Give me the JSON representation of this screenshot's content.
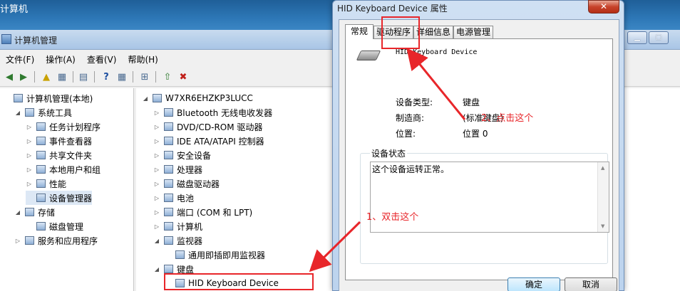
{
  "desktop": {
    "title": "计算机"
  },
  "mmc": {
    "title": "计算机管理",
    "menu": [
      "文件(F)",
      "操作(A)",
      "查看(V)",
      "帮助(H)"
    ]
  },
  "left_tree": [
    {
      "label": "计算机管理(本地)",
      "depth": 0,
      "expander": "",
      "icon": "computer-management-icon"
    },
    {
      "label": "系统工具",
      "depth": 1,
      "expander": "◢",
      "icon": "tools-icon"
    },
    {
      "label": "任务计划程序",
      "depth": 2,
      "expander": "▷",
      "icon": "clock-icon"
    },
    {
      "label": "事件查看器",
      "depth": 2,
      "expander": "▷",
      "icon": "event-viewer-icon"
    },
    {
      "label": "共享文件夹",
      "depth": 2,
      "expander": "▷",
      "icon": "shared-folder-icon"
    },
    {
      "label": "本地用户和组",
      "depth": 2,
      "expander": "▷",
      "icon": "users-icon"
    },
    {
      "label": "性能",
      "depth": 2,
      "expander": "▷",
      "icon": "performance-icon"
    },
    {
      "label": "设备管理器",
      "depth": 2,
      "expander": "",
      "icon": "device-manager-icon"
    },
    {
      "label": "存储",
      "depth": 1,
      "expander": "◢",
      "icon": "storage-icon"
    },
    {
      "label": "磁盘管理",
      "depth": 2,
      "expander": "",
      "icon": "disk-icon"
    },
    {
      "label": "服务和应用程序",
      "depth": 1,
      "expander": "▷",
      "icon": "services-icon"
    }
  ],
  "right_tree": [
    {
      "label": "W7XR6EHZKP3LUCC",
      "depth": 0,
      "expander": "◢",
      "icon": "computer-icon"
    },
    {
      "label": "Bluetooth 无线电收发器",
      "depth": 1,
      "expander": "▷",
      "icon": "bluetooth-icon"
    },
    {
      "label": "DVD/CD-ROM 驱动器",
      "depth": 1,
      "expander": "▷",
      "icon": "dvd-icon"
    },
    {
      "label": "IDE ATA/ATAPI 控制器",
      "depth": 1,
      "expander": "▷",
      "icon": "ide-icon"
    },
    {
      "label": "安全设备",
      "depth": 1,
      "expander": "▷",
      "icon": "key-icon"
    },
    {
      "label": "处理器",
      "depth": 1,
      "expander": "▷",
      "icon": "processor-icon"
    },
    {
      "label": "磁盘驱动器",
      "depth": 1,
      "expander": "▷",
      "icon": "disk-drive-icon"
    },
    {
      "label": "电池",
      "depth": 1,
      "expander": "▷",
      "icon": "battery-icon"
    },
    {
      "label": "端口 (COM 和 LPT)",
      "depth": 1,
      "expander": "▷",
      "icon": "port-icon"
    },
    {
      "label": "计算机",
      "depth": 1,
      "expander": "▷",
      "icon": "computer-icon"
    },
    {
      "label": "监视器",
      "depth": 1,
      "expander": "◢",
      "icon": "monitor-icon"
    },
    {
      "label": "通用即插即用监视器",
      "depth": 2,
      "expander": "",
      "icon": "monitor-warning-icon"
    },
    {
      "label": "键盘",
      "depth": 1,
      "expander": "◢",
      "icon": "keyboard-icon"
    },
    {
      "label": "HID Keyboard Device",
      "depth": 2,
      "expander": "",
      "icon": "keyboard-icon"
    }
  ],
  "dialog": {
    "title": "HID Keyboard Device 属性",
    "close": "✕",
    "tabs": [
      "常规",
      "驱动程序",
      "详细信息",
      "电源管理"
    ],
    "device_name": "HID Keyboard Device",
    "props": [
      {
        "label": "设备类型:",
        "value": "键盘"
      },
      {
        "label": "制造商:",
        "value": "(标准键盘)"
      },
      {
        "label": "位置:",
        "value": "位置 0"
      }
    ],
    "status_label": "设备状态",
    "status_text": "这个设备运转正常。",
    "ok": "确定",
    "cancel": "取消"
  },
  "annotations": {
    "step1": "1、双击这个",
    "step2": "2、点击这个",
    "color": "#e8262a"
  }
}
